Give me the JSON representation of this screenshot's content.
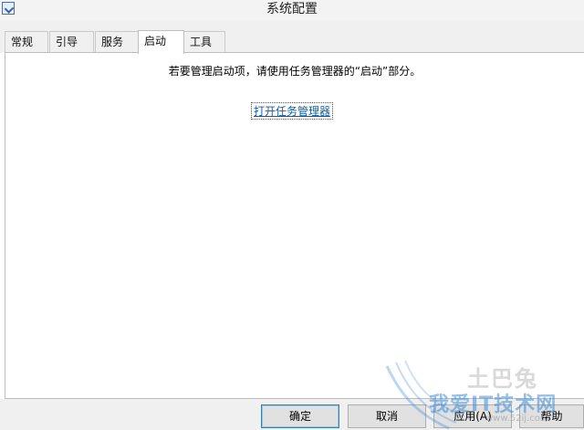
{
  "window": {
    "title": "系统配置",
    "icon": "msconfig-icon"
  },
  "tabs": [
    {
      "label": "常规",
      "active": false
    },
    {
      "label": "引导",
      "active": false
    },
    {
      "label": "服务",
      "active": false
    },
    {
      "label": "启动",
      "active": true
    },
    {
      "label": "工具",
      "active": false
    }
  ],
  "startup": {
    "message": "若要管理启动项，请使用任务管理器的“启动”部分。",
    "link_label": "打开任务管理器"
  },
  "buttons": {
    "ok": "确定",
    "cancel": "取消",
    "apply": "应用(A)",
    "help": "帮助"
  },
  "watermark": {
    "logo_text": "土巴兔",
    "site_text": "我爱IT技术网",
    "url_text": "www.52ij.com"
  },
  "colors": {
    "link": "#0a5fa8",
    "watermark_blue": "#3c8cd7"
  }
}
